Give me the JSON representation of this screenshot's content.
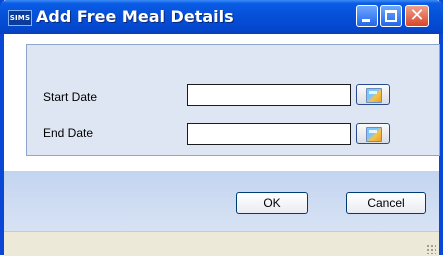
{
  "window": {
    "title": "Add Free Meal Details",
    "app_badge": "SIMS"
  },
  "form": {
    "start_date": {
      "label": "Start Date",
      "value": ""
    },
    "end_date": {
      "label": "End Date",
      "value": ""
    }
  },
  "buttons": {
    "ok": "OK",
    "cancel": "Cancel"
  },
  "icons": {
    "minimize": "minimize-icon",
    "maximize": "maximize-icon",
    "close": "close-icon",
    "calendar": "calendar-icon"
  },
  "colors": {
    "titlebar": "#0650d8",
    "panel": "#dfe6f3",
    "close_button": "#d8452a"
  }
}
